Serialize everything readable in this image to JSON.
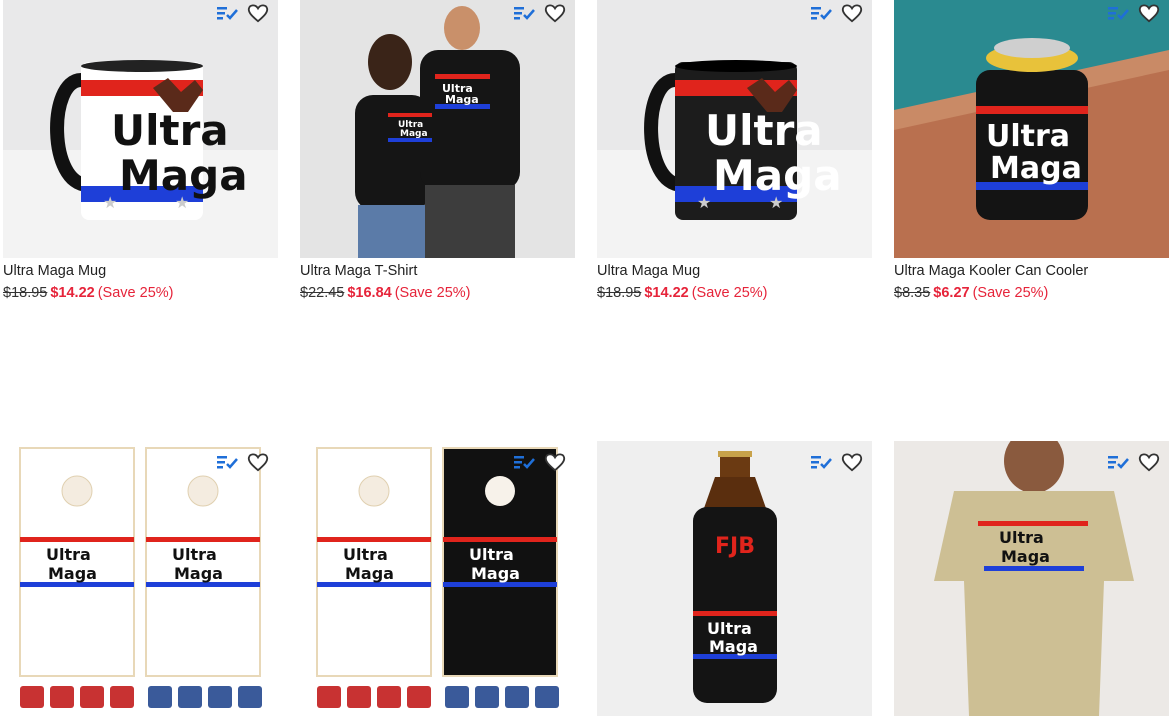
{
  "colors": {
    "sale": "#e6243a",
    "compare_icon": "#1f6fd8",
    "heart": "#333333"
  },
  "icons": {
    "compare": "compare-icon",
    "favorite": "heart-icon"
  },
  "products": [
    {
      "title": "Ultra Maga Mug",
      "old_price": "$18.95",
      "price": "$14.22",
      "savings": "(Save 25%)",
      "art_text": [
        "Ultra",
        "Maga"
      ]
    },
    {
      "title": "Ultra Maga T-Shirt",
      "old_price": "$22.45",
      "price": "$16.84",
      "savings": "(Save 25%)",
      "art_text": [
        "Ultra",
        "Maga"
      ]
    },
    {
      "title": "Ultra Maga Mug",
      "old_price": "$18.95",
      "price": "$14.22",
      "savings": "(Save 25%)",
      "art_text": [
        "Ultra",
        "Maga"
      ]
    },
    {
      "title": "Ultra Maga Kooler Can Cooler",
      "old_price": "$8.35",
      "price": "$6.27",
      "savings": "(Save 25%)",
      "art_text": [
        "Ultra",
        "Maga"
      ]
    },
    {
      "art_text": [
        "Ultra",
        "Maga"
      ]
    },
    {
      "art_text": [
        "Ultra",
        "Maga"
      ]
    },
    {
      "art_text": [
        "FJB",
        "Ultra",
        "Maga"
      ]
    },
    {
      "art_text": [
        "Ultra",
        "Maga"
      ]
    }
  ]
}
